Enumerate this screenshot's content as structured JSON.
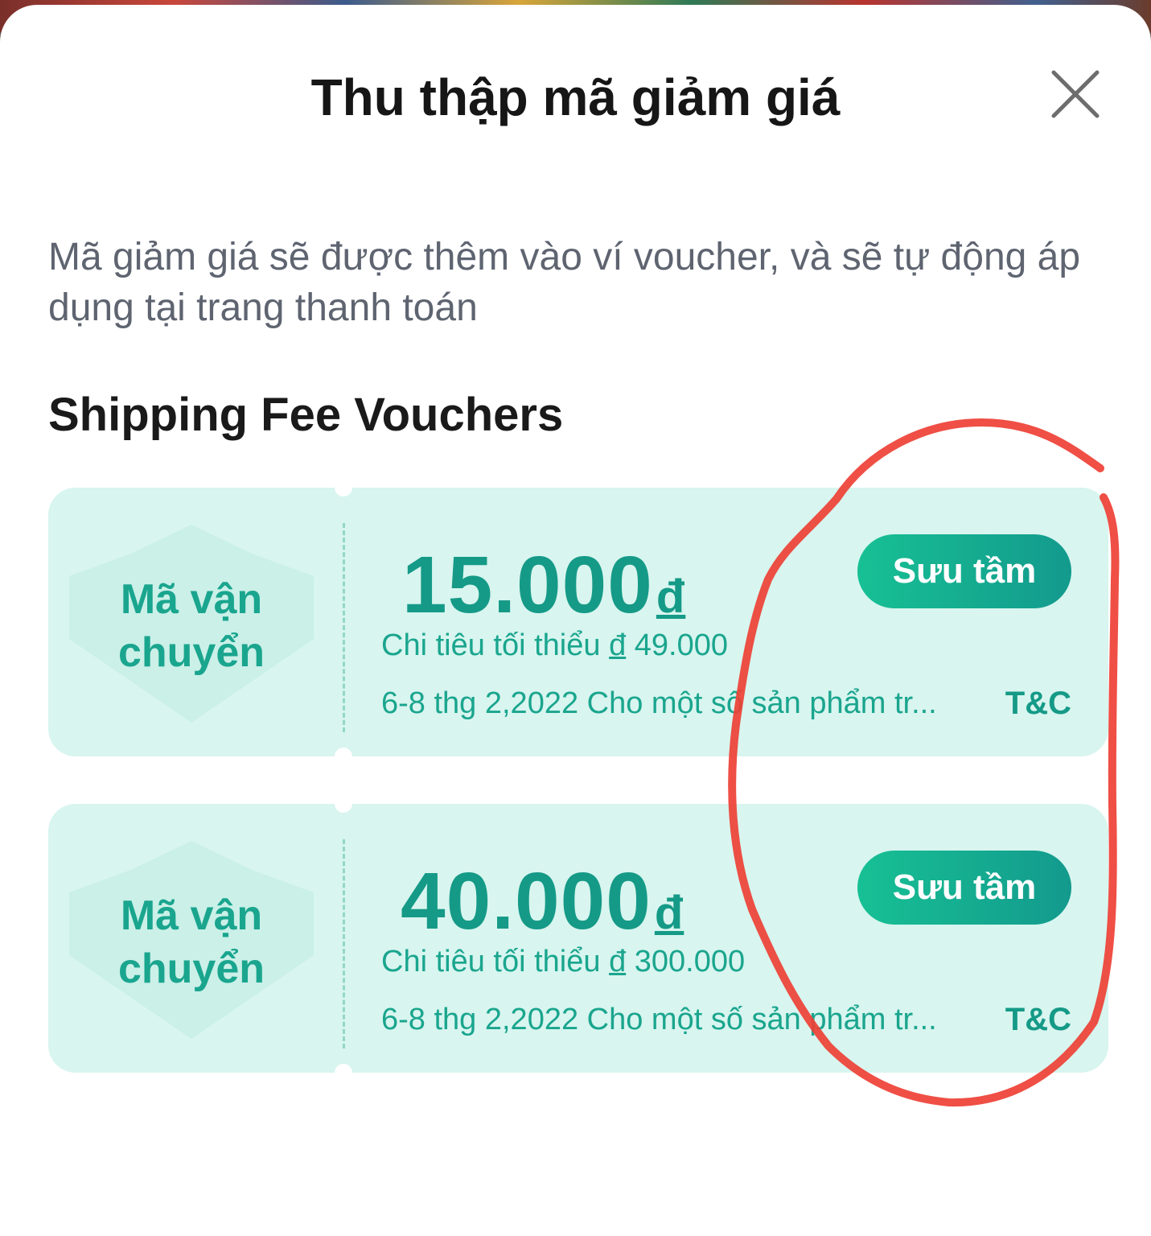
{
  "sheet": {
    "title": "Thu thập mã giảm giá",
    "description": "Mã giảm giá sẽ được thêm vào ví voucher, và sẽ tự động áp dụng tại trang thanh toán",
    "section_title": "Shipping Fee Vouchers"
  },
  "icons": {
    "close": "close-icon"
  },
  "colors": {
    "accent": "#159a87",
    "voucher_bg": "#d8f5ef",
    "button_gradient_start": "#17c094",
    "button_gradient_end": "#139a8d",
    "annotation": "#ee4035"
  },
  "vouchers": [
    {
      "badge_line1": "Mã vận",
      "badge_line2": "chuyển",
      "amount": "15.000",
      "currency": "đ",
      "min_spend_prefix": "Chi tiêu tối thiểu ",
      "min_spend_currency": "đ",
      "min_spend_value": " 49.000",
      "validity": "6-8 thg 2,2022 Cho một số sản phẩm tr...",
      "tc_label": "T&C",
      "button_label": "Sưu tầm"
    },
    {
      "badge_line1": "Mã vận",
      "badge_line2": "chuyển",
      "amount": "40.000",
      "currency": "đ",
      "min_spend_prefix": "Chi tiêu tối thiểu ",
      "min_spend_currency": "đ",
      "min_spend_value": " 300.000",
      "validity": "6-8 thg 2,2022 Cho một số sản phẩm tr...",
      "tc_label": "T&C",
      "button_label": "Sưu tầm"
    }
  ]
}
